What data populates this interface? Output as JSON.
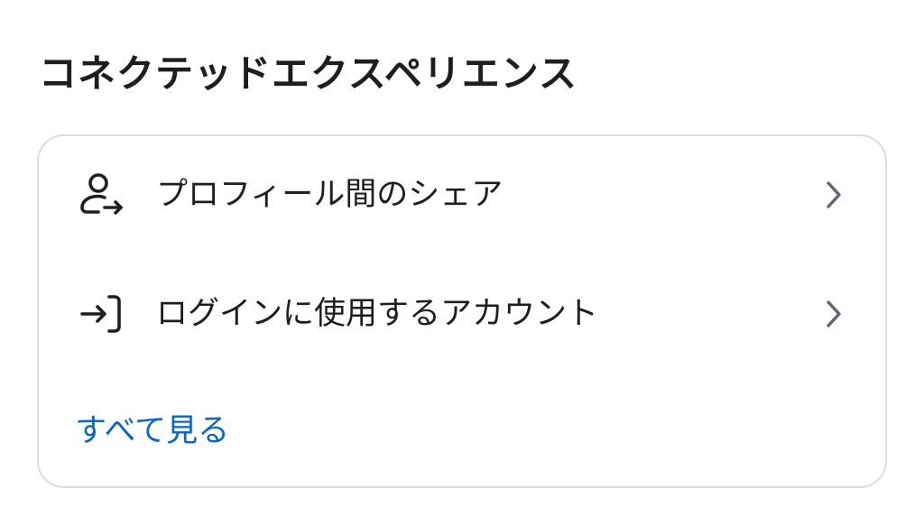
{
  "section": {
    "title": "コネクテッドエクスペリエンス"
  },
  "card": {
    "items": [
      {
        "label": "プロフィール間のシェア",
        "icon": "profile-share-icon"
      },
      {
        "label": "ログインに使用するアカウント",
        "icon": "login-arrow-icon"
      }
    ],
    "see_all_label": "すべて見る"
  },
  "colors": {
    "text": "#1c1e21",
    "link": "#0a66c2",
    "border": "#dadde1",
    "chevron": "#606770"
  }
}
